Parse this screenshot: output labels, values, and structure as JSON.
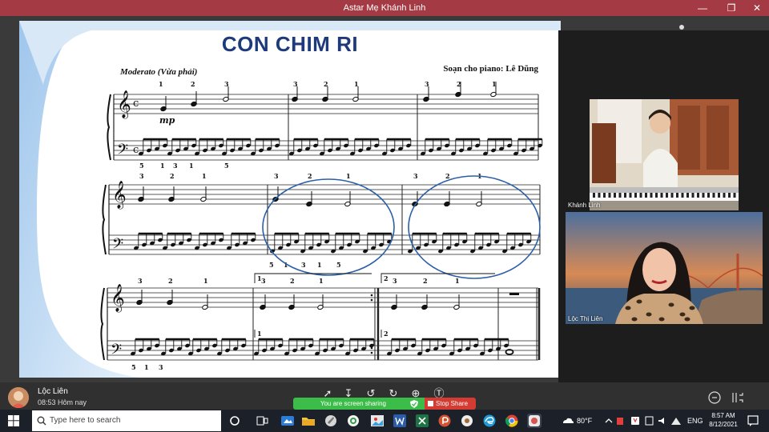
{
  "window": {
    "title": "Astar Mẹ Khánh Linh"
  },
  "slide": {
    "title": "CON CHIM RI",
    "tempo": "Moderato (Vừa phải)",
    "arranger": "Soạn cho piano: Lê Dũng",
    "dynamic": "mp",
    "fingerings_row1": [
      "1",
      "2",
      "3",
      "3",
      "2",
      "1",
      "3",
      "2",
      "1"
    ],
    "fingerings_bass_row1": [
      "5",
      "1",
      "3",
      "1",
      "5"
    ],
    "fingerings_row2": [
      "3",
      "2",
      "1",
      "3",
      "2",
      "1",
      "3",
      "2",
      "1"
    ],
    "fingerings_bass_row2": [
      "5",
      "1",
      "3",
      "1",
      "5"
    ],
    "fingerings_row3": [
      "3",
      "2",
      "1",
      "3",
      "2",
      "1",
      "3",
      "2",
      "1"
    ],
    "fingerings_bass_row3": [
      "5",
      "1",
      "3"
    ],
    "volta_1": "1",
    "volta_2": "2"
  },
  "participants": [
    {
      "name": "Khánh Linh"
    },
    {
      "name": "Lộc Thị Liên"
    }
  ],
  "notification": {
    "sender": "Lộc Liên",
    "time": "08:53 Hôm nay"
  },
  "share_bar": {
    "status": "You are screen sharing",
    "stop_label": "Stop Share"
  },
  "taskbar": {
    "search_placeholder": "Type here to search",
    "weather": "80°F",
    "language": "ENG",
    "time": "8:57 AM",
    "date": "8/12/2021"
  },
  "colors": {
    "titlebar": "#a43a43",
    "title_text": "#1f3a7a",
    "circle": "#2a5fa8",
    "share_green": "#3cbd49",
    "stop_red": "#d33b33"
  }
}
